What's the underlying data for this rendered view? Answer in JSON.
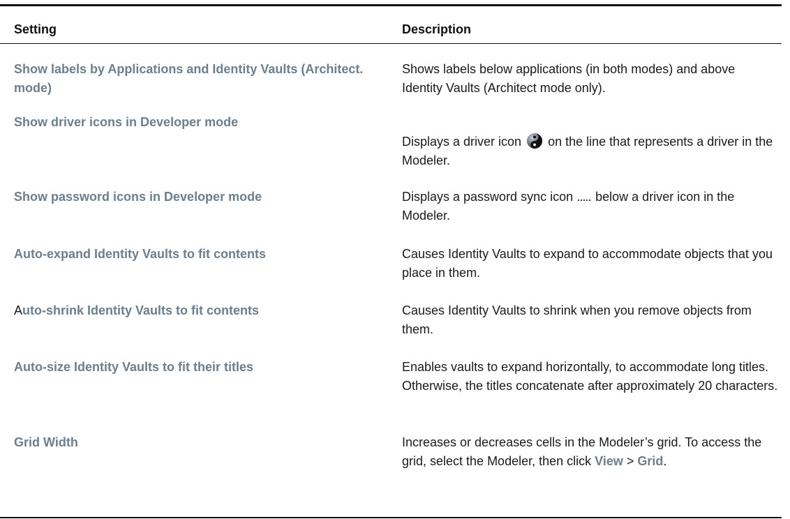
{
  "table": {
    "headers": {
      "setting": "Setting",
      "description": "Description"
    },
    "rows": [
      {
        "setting": "Show labels by Applications and Identity Vaults (Architect. mode)",
        "description": "Shows labels below applications (in both modes) and above Identity Vaults (Architect mode only)."
      },
      {
        "setting": "Show driver icons in Developer mode",
        "description_before": "Displays a driver icon",
        "description_after": "on the line that represents a driver in the Modeler.",
        "icon": "yin-yang-driver-icon"
      },
      {
        "setting": "Show password icons in Developer mode",
        "description_before": "Displays a password sync icon",
        "description_after": "below a driver icon in the Modeler.",
        "icon": "password-sync-icon"
      },
      {
        "setting": "Auto-expand Identity Vaults to fit contents",
        "description": "Causes Identity Vaults to expand to accommodate objects that you place in them."
      },
      {
        "setting_lead": "A",
        "setting": "uto-shrink Identity Vaults to fit contents",
        "description": "Causes Identity Vaults to shrink when you remove objects from them."
      },
      {
        "setting": "Auto-size Identity Vaults to fit their titles",
        "description": "Enables vaults to expand horizontally, to accommodate long titles. Otherwise, the titles concatenate after approximately 20 characters."
      },
      {
        "setting": "Grid Width",
        "description_before": "Increases or decreases cells in the Modeler’s grid. To access the grid, select the Modeler, then click",
        "link_view": "View",
        "separator": ">",
        "link_grid": "Grid",
        "end": "."
      }
    ]
  }
}
